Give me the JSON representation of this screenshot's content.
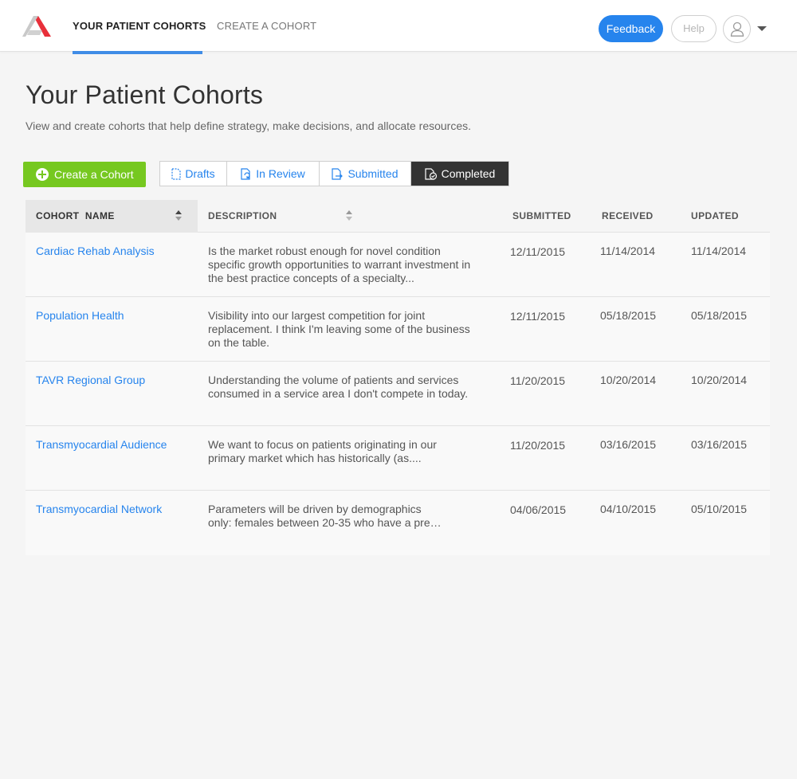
{
  "nav": {
    "tabs": [
      {
        "label": "YOUR PATIENT COHORTS",
        "active": true
      },
      {
        "label": "CREATE A COHORT",
        "active": false
      }
    ],
    "feedback_label": "Feedback",
    "help_label": "Help",
    "accent_color": "#2684ed",
    "brand_color": "#e8303a"
  },
  "page": {
    "title": "Your Patient Cohorts",
    "subtitle": "View and create cohorts that help define strategy, make decisions, and allocate resources."
  },
  "actions": {
    "create_label": "Create a Cohort",
    "create_color": "#76c820",
    "filters": [
      {
        "label": "Drafts",
        "icon": "draft-doc-icon",
        "selected": false
      },
      {
        "label": "In Review",
        "icon": "review-doc-icon",
        "selected": false
      },
      {
        "label": "Submitted",
        "icon": "submitted-doc-icon",
        "selected": false
      },
      {
        "label": "Completed",
        "icon": "completed-doc-icon",
        "selected": true
      }
    ]
  },
  "table": {
    "columns": {
      "name": "COHORT  NAME",
      "description": "DESCRIPTION",
      "submitted": "SUBMITTED",
      "received": "RECEIVED",
      "updated": "UPDATED"
    },
    "rows": [
      {
        "name": "Cardiac Rehab Analysis",
        "description": "Is the market robust enough for novel condition specific growth opportunities to warrant investment in the best practice concepts of a specialty...",
        "submitted": "12/11/2015",
        "received": "11/14/2014",
        "updated": "11/14/2014"
      },
      {
        "name": "Population Health",
        "description": "Visibility into our largest competition for joint replacement. I think I'm leaving some of the business on the table.",
        "submitted": "12/11/2015",
        "received": "05/18/2015",
        "updated": "05/18/2015"
      },
      {
        "name": "TAVR Regional Group",
        "description": "Understanding the volume of patients and services consumed in a service area I don't compete in today.",
        "submitted": "11/20/2015",
        "received": "10/20/2014",
        "updated": "10/20/2014"
      },
      {
        "name": "Transmyocardial Audience",
        "description": "We want to focus on patients originating in our primary market which has historically (as....",
        "submitted": "11/20/2015",
        "received": "03/16/2015",
        "updated": "03/16/2015"
      },
      {
        "name": "Transmyocardial Network",
        "description": "Parameters will be driven by demographics only: females between 20-35 who have a pre…",
        "submitted": "04/06/2015",
        "received": "04/10/2015",
        "updated": "05/10/2015"
      }
    ]
  }
}
